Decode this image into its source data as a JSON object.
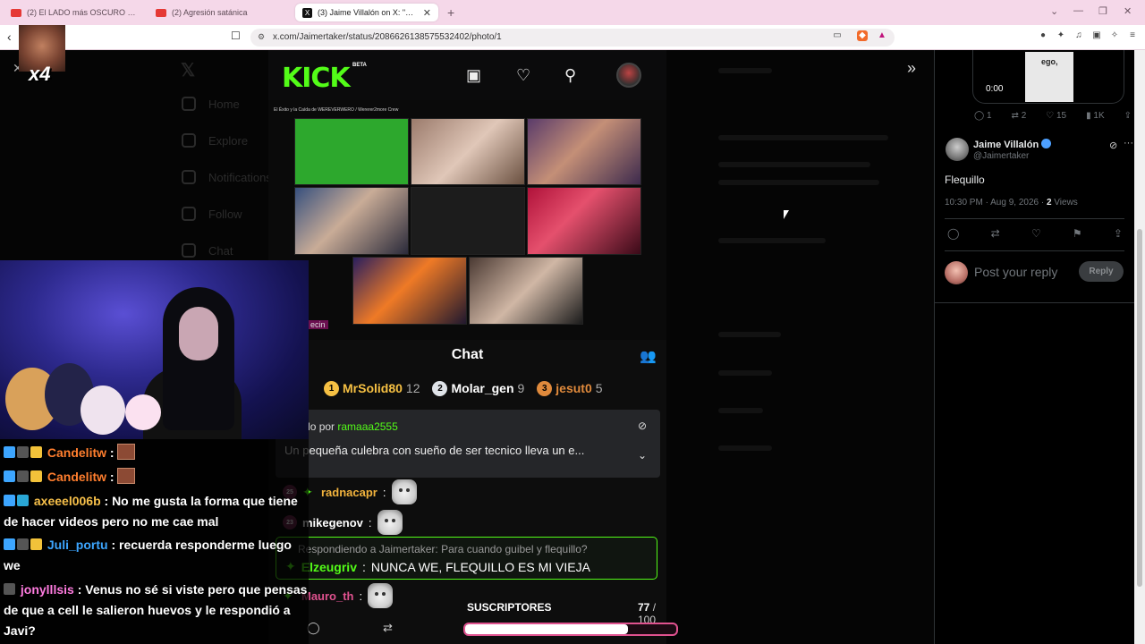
{
  "browser": {
    "tabs": [
      {
        "label": "(2) El LADO más OSCURO de la RELI",
        "kind": "youtube"
      },
      {
        "label": "(2) Agresión satánica",
        "kind": "youtube"
      },
      {
        "label": "(3) Jaime Villalón on X: \"@ve",
        "kind": "x",
        "active": true
      }
    ],
    "url": "x.com/Jaimertaker/status/2086626138575532402/photo/1"
  },
  "x_nav_faint": [
    "Home",
    "Explore",
    "Notifications",
    "Follow",
    "Chat"
  ],
  "kick": {
    "logo": "KICK",
    "beta": "BETA",
    "video_title": "El Éxito y la Caída de WEREVERWERO / Wererer2more Crew",
    "video_credit": "ecin",
    "chat_title": "Chat",
    "leaderboard": [
      {
        "rank": "1",
        "name": "MrSolid80",
        "score": "12",
        "color": "#f6c043"
      },
      {
        "rank": "2",
        "name": "Molar_gen",
        "score": "9",
        "color": "#dfe3e8"
      },
      {
        "rank": "3",
        "name": "jesut0",
        "score": "5",
        "color": "#e08a3c"
      }
    ],
    "pinned": {
      "by_prefix": "nviado por",
      "by_user": "ramaaa2555",
      "message": "Un pequeña culebra con sueño de ser tecnico lleva un e..."
    },
    "messages": [
      {
        "level": "25",
        "user": "radnacapr",
        "color": "#f2b33d"
      },
      {
        "level": "23",
        "user": "mikegenov",
        "color": "#ffffff"
      }
    ],
    "reply": {
      "ref": "Respondiendo a Jaimertaker: Para cuando guibel y flequillo?",
      "user": "Elzeugriv",
      "text": "NUNCA WE, FLEQUILLO ES MI VIEJA"
    },
    "last_message_user": "Mauro_th",
    "subs": {
      "label": "SUSCRIPTORES",
      "current": "77",
      "total": "100",
      "fraction": 0.77
    }
  },
  "overlay": {
    "badge_label": "x4",
    "chat": [
      {
        "user": "Candelitw",
        "text": ":",
        "name_class": "oname-orange"
      },
      {
        "user": "Candelitw",
        "text": ":",
        "name_class": "oname-orange"
      },
      {
        "user": "axeeel006b",
        "text": ": No me gusta la forma que tiene de hacer videos pero no me cae mal",
        "name_class": "oname-yellow"
      },
      {
        "user": "Juli_portu",
        "text": ": recuerda responderme luego we",
        "name_class": "oname-blue"
      },
      {
        "user": "jonylllsis",
        "text": ": Venus no sé si viste pero que pensas de que a cell le salieron huevos y le respondió a Javi?",
        "name_class": "oname-pink"
      }
    ]
  },
  "x_post": {
    "video_time": "0:00",
    "thumb_word": "ego,",
    "engagement_top": {
      "replies": "1",
      "reposts": "2",
      "likes": "15",
      "views": "1K"
    },
    "author_name": "Jaime Villalón",
    "author_handle": "@Jaimertaker",
    "text": "Flequillo",
    "meta": "10:30 PM · Aug 9, 2026 · ",
    "views_count": "2",
    "views_label": " Views",
    "reply_placeholder": "Post your reply",
    "reply_button": "Reply"
  },
  "colors": {
    "kick_green": "#53fc18",
    "x_bg": "#000000",
    "sub_bar_border": "#e0528f"
  }
}
